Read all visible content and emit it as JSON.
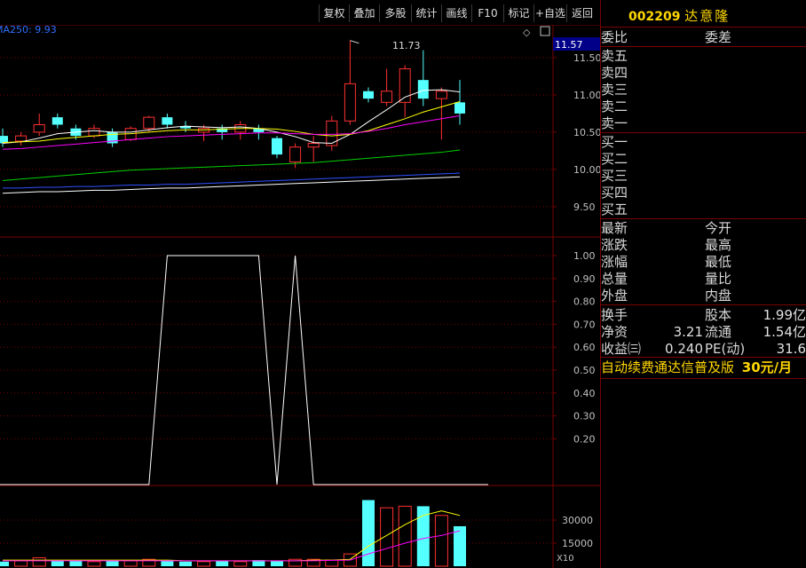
{
  "toolbar": {
    "buttons": [
      "复权",
      "叠加",
      "多股",
      "统计",
      "画线",
      "F10",
      "标记",
      "+自选",
      "返回"
    ]
  },
  "main_chart": {
    "ma_label": "MA250: 9.93",
    "peak_label": "11.73",
    "current_price_label": "11.57",
    "price_axis": [
      "11.50",
      "11.00",
      "10.50",
      "10.00",
      "9.50"
    ]
  },
  "indicator": {
    "axis": [
      "1.00",
      "0.90",
      "0.80",
      "0.70",
      "0.60",
      "0.50",
      "0.40",
      "0.30",
      "0.20"
    ]
  },
  "volume": {
    "axis": [
      "30000",
      "15000"
    ],
    "unit": "X10"
  },
  "chart_data": [
    {
      "type": "candlestick",
      "title": "",
      "ylim": [
        9.2,
        11.75
      ],
      "candles": [
        {
          "o": 10.45,
          "c": 10.35,
          "h": 10.55,
          "l": 10.3
        },
        {
          "o": 10.38,
          "c": 10.45,
          "h": 10.5,
          "l": 10.32
        },
        {
          "o": 10.5,
          "c": 10.6,
          "h": 10.75,
          "l": 10.45
        },
        {
          "o": 10.7,
          "c": 10.6,
          "h": 10.75,
          "l": 10.55
        },
        {
          "o": 10.55,
          "c": 10.45,
          "h": 10.6,
          "l": 10.4
        },
        {
          "o": 10.45,
          "c": 10.55,
          "h": 10.6,
          "l": 10.42
        },
        {
          "o": 10.5,
          "c": 10.35,
          "h": 10.55,
          "l": 10.3
        },
        {
          "o": 10.4,
          "c": 10.55,
          "h": 10.58,
          "l": 10.38
        },
        {
          "o": 10.55,
          "c": 10.7,
          "h": 10.72,
          "l": 10.5
        },
        {
          "o": 10.7,
          "c": 10.6,
          "h": 10.75,
          "l": 10.55
        },
        {
          "o": 10.58,
          "c": 10.55,
          "h": 10.65,
          "l": 10.5
        },
        {
          "o": 10.5,
          "c": 10.55,
          "h": 10.6,
          "l": 10.38
        },
        {
          "o": 10.55,
          "c": 10.5,
          "h": 10.6,
          "l": 10.4
        },
        {
          "o": 10.5,
          "c": 10.6,
          "h": 10.65,
          "l": 10.4
        },
        {
          "o": 10.55,
          "c": 10.5,
          "h": 10.6,
          "l": 10.4
        },
        {
          "o": 10.42,
          "c": 10.2,
          "h": 10.45,
          "l": 10.15
        },
        {
          "o": 10.1,
          "c": 10.3,
          "h": 10.35,
          "l": 10.02
        },
        {
          "o": 10.3,
          "c": 10.35,
          "h": 10.45,
          "l": 10.1
        },
        {
          "o": 10.32,
          "c": 10.65,
          "h": 10.72,
          "l": 10.25
        },
        {
          "o": 10.65,
          "c": 11.15,
          "h": 11.73,
          "l": 10.6
        },
        {
          "o": 11.05,
          "c": 10.95,
          "h": 11.1,
          "l": 10.9
        },
        {
          "o": 10.9,
          "c": 11.05,
          "h": 11.35,
          "l": 10.85
        },
        {
          "o": 10.9,
          "c": 11.35,
          "h": 11.4,
          "l": 10.7
        },
        {
          "o": 11.2,
          "c": 10.95,
          "h": 11.6,
          "l": 10.85
        },
        {
          "o": 10.95,
          "c": 11.05,
          "h": 11.1,
          "l": 10.4
        },
        {
          "o": 10.9,
          "c": 10.75,
          "h": 11.2,
          "l": 10.6
        }
      ],
      "ma_lines": [
        {
          "name": "MA5",
          "color": "#ffffff",
          "values": [
            10.35,
            10.37,
            10.42,
            10.48,
            10.5,
            10.52,
            10.5,
            10.5,
            10.53,
            10.56,
            10.58,
            10.57,
            10.56,
            10.57,
            10.55,
            10.5,
            10.44,
            10.36,
            10.35,
            10.47,
            10.64,
            10.8,
            10.97,
            11.06,
            11.07,
            11.04
          ]
        },
        {
          "name": "MA10",
          "color": "#ffff00",
          "values": [
            10.36,
            10.37,
            10.38,
            10.41,
            10.43,
            10.45,
            10.47,
            10.48,
            10.5,
            10.52,
            10.53,
            10.53,
            10.54,
            10.55,
            10.55,
            10.54,
            10.51,
            10.47,
            10.45,
            10.47,
            10.52,
            10.6,
            10.68,
            10.77,
            10.84,
            10.91
          ]
        },
        {
          "name": "MA20",
          "color": "#ff00ff",
          "values": [
            10.27,
            10.28,
            10.3,
            10.32,
            10.34,
            10.36,
            10.38,
            10.4,
            10.42,
            10.44,
            10.45,
            10.46,
            10.47,
            10.48,
            10.49,
            10.49,
            10.48,
            10.47,
            10.47,
            10.48,
            10.51,
            10.55,
            10.6,
            10.64,
            10.68,
            10.72
          ]
        },
        {
          "name": "MA60",
          "color": "#00d000",
          "values": [
            9.85,
            9.87,
            9.89,
            9.91,
            9.93,
            9.95,
            9.97,
            9.99,
            10.0,
            10.01,
            10.02,
            10.03,
            10.04,
            10.05,
            10.06,
            10.07,
            10.08,
            10.09,
            10.11,
            10.13,
            10.15,
            10.17,
            10.19,
            10.21,
            10.23,
            10.26
          ]
        },
        {
          "name": "MA120",
          "color": "#3050ff",
          "values": [
            9.75,
            9.75,
            9.76,
            9.76,
            9.77,
            9.77,
            9.78,
            9.79,
            9.79,
            9.8,
            9.8,
            9.81,
            9.82,
            9.83,
            9.84,
            9.85,
            9.86,
            9.87,
            9.88,
            9.89,
            9.9,
            9.91,
            9.92,
            9.93,
            9.94,
            9.95
          ]
        },
        {
          "name": "MA250",
          "color": "#ffffff",
          "values": [
            9.68,
            9.69,
            9.7,
            9.7,
            9.71,
            9.72,
            9.72,
            9.73,
            9.74,
            9.75,
            9.75,
            9.76,
            9.77,
            9.78,
            9.79,
            9.8,
            9.81,
            9.82,
            9.83,
            9.84,
            9.85,
            9.86,
            9.87,
            9.88,
            9.89,
            9.9
          ]
        }
      ]
    },
    {
      "type": "line",
      "title": "",
      "ylim": [
        0,
        1.05
      ],
      "values": [
        0,
        0,
        0,
        0,
        0,
        0,
        0,
        0,
        0,
        1,
        1,
        1,
        1,
        1,
        1,
        0,
        1,
        0,
        0,
        0,
        0,
        0,
        0,
        0,
        0,
        0
      ]
    },
    {
      "type": "bar",
      "title": "",
      "ylim": [
        0,
        45000
      ],
      "values": [
        3000,
        3500,
        5500,
        4000,
        3500,
        3000,
        4000,
        3500,
        4500,
        3500,
        3000,
        3000,
        3500,
        3000,
        4000,
        3500,
        4500,
        4500,
        4000,
        8000,
        43000,
        38000,
        39000,
        39000,
        33000,
        26000
      ],
      "ma_lines": [
        {
          "color": "#ffff00",
          "values": [
            4000,
            4000,
            4000,
            4000,
            4000,
            4000,
            4000,
            4000,
            4000,
            4000,
            3500,
            3500,
            3500,
            3500,
            3500,
            3500,
            3500,
            4000,
            4000,
            4500,
            13000,
            20000,
            27000,
            33000,
            36000,
            33000
          ]
        },
        {
          "color": "#ff00ff",
          "values": [
            3500,
            3500,
            3500,
            3500,
            3500,
            3500,
            3500,
            3500,
            3500,
            3500,
            3500,
            3500,
            3500,
            3500,
            3500,
            3500,
            3500,
            3500,
            3800,
            4000,
            8000,
            11500,
            15000,
            18000,
            20000,
            23000
          ]
        }
      ]
    }
  ],
  "stock": {
    "code": "002209",
    "name": "达意隆"
  },
  "quote": {
    "wei_bi": "委比",
    "wei_cha": "委差",
    "sell": [
      "卖五",
      "卖四",
      "卖三",
      "卖二",
      "卖一"
    ],
    "buy": [
      "买一",
      "买二",
      "买三",
      "买四",
      "买五"
    ],
    "stats_left": [
      "最新",
      "涨跌",
      "涨幅",
      "总量",
      "外盘"
    ],
    "stats_right": [
      "今开",
      "最高",
      "最低",
      "量比",
      "内盘"
    ],
    "fin": [
      {
        "l1": "换手",
        "v1": "",
        "l2": "股本",
        "v2": "1.99亿"
      },
      {
        "l1": "净资",
        "v1": "3.21",
        "l2": "流通",
        "v2": "1.54亿"
      },
      {
        "l1": "收益㈢",
        "v1": "0.240",
        "l2": "PE(动)",
        "v2": "31.6"
      }
    ],
    "promo_text": "自动续费通达信普及版",
    "promo_price": "30元/月"
  },
  "colors": {
    "up": "#ff3030",
    "down": "#54ffff",
    "grid": "#7a0000",
    "axis_text": "#c0c0c0",
    "ma_label": "#2f6fff",
    "price_box": "#000088"
  }
}
